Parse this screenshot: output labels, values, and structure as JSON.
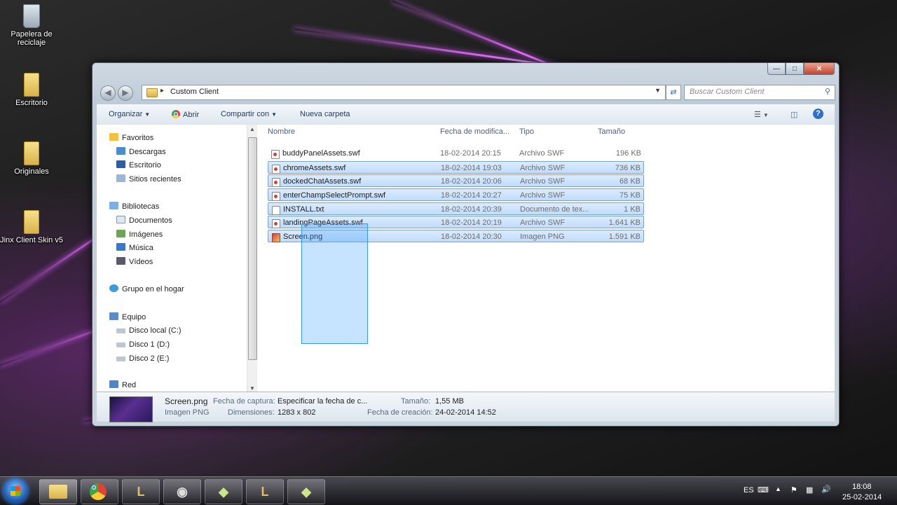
{
  "desktop": {
    "icons": [
      {
        "label": "Papelera de reciclaje",
        "icon": "recycle-bin-icon"
      },
      {
        "label": "Escritorio",
        "icon": "folder-icon"
      },
      {
        "label": "Originales",
        "icon": "folder-icon"
      },
      {
        "label": "Jinx Client Skin v5",
        "icon": "folder-icon"
      }
    ]
  },
  "window": {
    "address_path": "Custom Client",
    "search_placeholder": "Buscar Custom Client",
    "toolbar": {
      "organize": "Organizar",
      "open": "Abrir",
      "share": "Compartir con",
      "new_folder": "Nueva carpeta"
    },
    "nav": {
      "favorites": "Favoritos",
      "downloads": "Descargas",
      "desktop": "Escritorio",
      "recent": "Sitios recientes",
      "libraries": "Bibliotecas",
      "documents": "Documentos",
      "images": "Imágenes",
      "music": "Música",
      "videos": "Vídeos",
      "homegroup": "Grupo en el hogar",
      "computer": "Equipo",
      "disk_c": "Disco local (C:)",
      "disk_d": "Disco 1 (D:)",
      "disk_e": "Disco 2 (E:)",
      "network": "Red"
    },
    "columns": {
      "name": "Nombre",
      "date": "Fecha de modifica...",
      "type": "Tipo",
      "size": "Tamaño"
    },
    "files": [
      {
        "name": "buddyPanelAssets.swf",
        "date": "18-02-2014 20:15",
        "type": "Archivo SWF",
        "size": "196 KB",
        "selected": false
      },
      {
        "name": "chromeAssets.swf",
        "date": "18-02-2014 19:03",
        "type": "Archivo SWF",
        "size": "736 KB",
        "selected": true
      },
      {
        "name": "dockedChatAssets.swf",
        "date": "18-02-2014 20:06",
        "type": "Archivo SWF",
        "size": "68 KB",
        "selected": true
      },
      {
        "name": "enterChampSelectPrompt.swf",
        "date": "18-02-2014 20:27",
        "type": "Archivo SWF",
        "size": "75 KB",
        "selected": true
      },
      {
        "name": "INSTALL.txt",
        "date": "18-02-2014 20:39",
        "type": "Documento de tex...",
        "size": "1 KB",
        "selected": true
      },
      {
        "name": "landingPageAssets.swf",
        "date": "18-02-2014 20:19",
        "type": "Archivo SWF",
        "size": "1.641 KB",
        "selected": true
      },
      {
        "name": "Screen.png",
        "date": "18-02-2014 20:30",
        "type": "Imagen PNG",
        "size": "1.591 KB",
        "selected": true
      }
    ],
    "details": {
      "filename": "Screen.png",
      "filetype": "Imagen PNG",
      "capture_label": "Fecha de captura:",
      "capture_value": "Especificar la fecha de c...",
      "dimensions_label": "Dimensiones:",
      "dimensions_value": "1283 x 802",
      "size_label": "Tamaño:",
      "size_value": "1,55 MB",
      "created_label": "Fecha de creación:",
      "created_value": "24-02-2014 14:52"
    }
  },
  "taskbar": {
    "lang": "ES",
    "time": "18:08",
    "date": "25-02-2014"
  }
}
